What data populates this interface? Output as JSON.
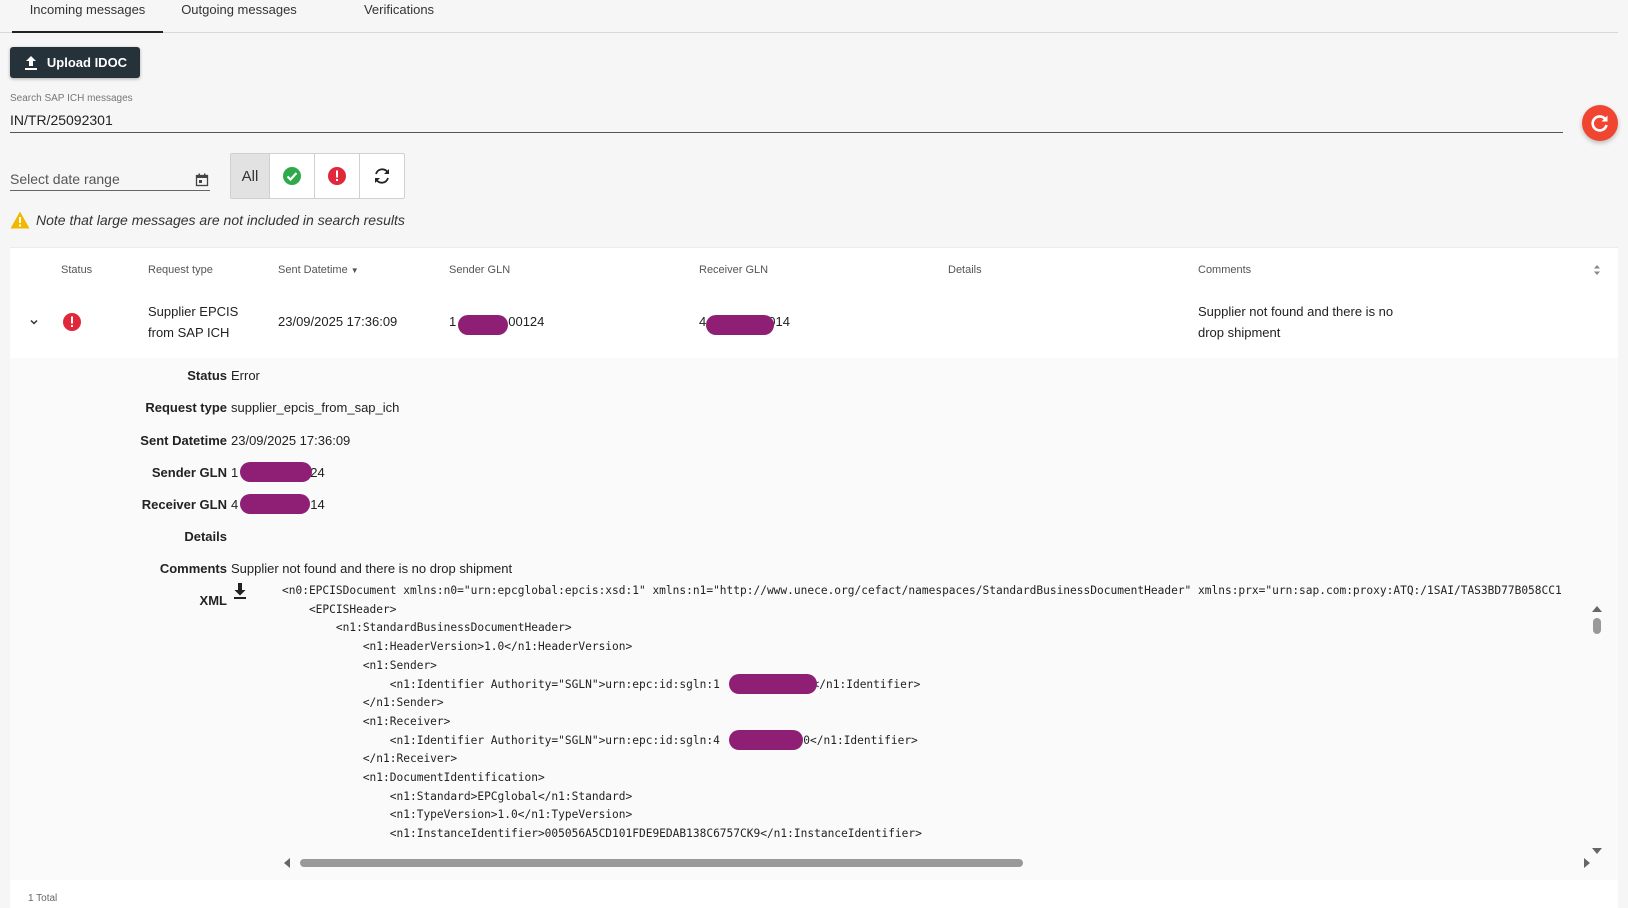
{
  "tabs": [
    {
      "label": "Incoming messages",
      "active": true
    },
    {
      "label": "Outgoing messages",
      "active": false
    },
    {
      "label": "Verifications",
      "active": false
    }
  ],
  "upload_button": {
    "label": "Upload IDOC",
    "icon": "upload-icon"
  },
  "search": {
    "label": "Search SAP ICH messages",
    "value": "IN/TR/25092301"
  },
  "refresh_button": {
    "icon": "refresh-icon",
    "color": "#f04530"
  },
  "date_range": {
    "placeholder": "Select date range",
    "icon": "calendar-icon"
  },
  "filters": [
    {
      "label": "All",
      "active": true
    },
    {
      "icon": "success-check-icon",
      "color": "#2eaa4a"
    },
    {
      "icon": "error-exclamation-icon",
      "color": "#e0283a"
    },
    {
      "icon": "sync-icon"
    }
  ],
  "note": {
    "text": "Note that large messages are not included in search results",
    "icon": "warning-icon",
    "color": "#f2b800"
  },
  "table": {
    "headers": [
      "Status",
      "Request type",
      "Sent Datetime",
      "Sender GLN",
      "Receiver GLN",
      "Details",
      "Comments"
    ],
    "sort_column": "Sent Datetime",
    "rows": [
      {
        "status_icon": "error-exclamation-icon",
        "request_type_line1": "Supplier EPCIS",
        "request_type_line2": "from SAP ICH",
        "sent_datetime": "23/09/2025 17:36:09",
        "sender_gln_prefix": "1",
        "sender_gln_suffix": "00124",
        "receiver_gln_prefix": "4",
        "receiver_gln_suffix": "014",
        "details": "",
        "comments_line1": "Supplier not found and there is no",
        "comments_line2": "drop shipment"
      }
    ]
  },
  "detail": {
    "labels": {
      "status": "Status",
      "request_type": "Request type",
      "sent_datetime": "Sent Datetime",
      "sender_gln": "Sender GLN",
      "receiver_gln": "Receiver GLN",
      "details": "Details",
      "comments": "Comments",
      "xml": "XML"
    },
    "values": {
      "status": "Error",
      "request_type": "supplier_epcis_from_sap_ich",
      "sent_datetime": "23/09/2025 17:36:09",
      "sender_gln_prefix": "1",
      "sender_gln_suffix": "24",
      "receiver_gln_prefix": "4",
      "receiver_gln_suffix": "14",
      "details": "",
      "comments": "Supplier not found and there is no drop shipment"
    },
    "xml_lines": [
      "<n0:EPCISDocument xmlns:n0=\"urn:epcglobal:epcis:xsd:1\" xmlns:n1=\"http://www.unece.org/cefact/namespaces/StandardBusinessDocumentHeader\" xmlns:prx=\"urn:sap.com:proxy:ATQ:/1SAI/TAS3BD77B058CC1",
      "    <EPCISHeader>",
      "        <n1:StandardBusinessDocumentHeader>",
      "            <n1:HeaderVersion>1.0</n1:HeaderVersion>",
      "            <n1:Sender>",
      "                <n1:Identifier Authority=\"SGLN\">urn:epc:id:sgln:1",
      "            </n1:Sender>",
      "            <n1:Receiver>",
      "                <n1:Identifier Authority=\"SGLN\">urn:epc:id:sgln:4",
      "            </n1:Receiver>",
      "            <n1:DocumentIdentification>",
      "                <n1:Standard>EPCglobal</n1:Standard>",
      "                <n1:TypeVersion>1.0</n1:TypeVersion>",
      "                <n1:InstanceIdentifier>005056A5CD101FDE9EDAB138C6757CK9</n1:InstanceIdentifier>"
    ],
    "xml_line6_suffix": "0</n1:Identifier>",
    "xml_line9_suffix": "1.0</n1:Identifier>"
  },
  "footer": {
    "total": "1 Total"
  },
  "colors": {
    "redaction": "#8e1f74",
    "primary_dark": "#26323a"
  }
}
